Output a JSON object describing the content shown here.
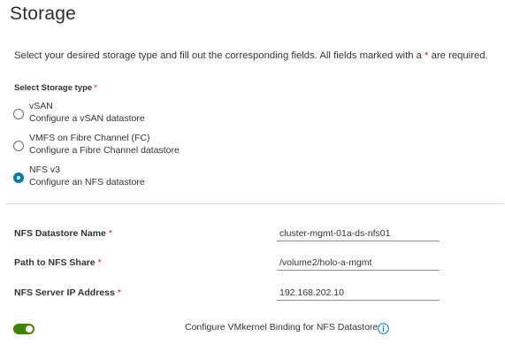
{
  "page": {
    "title": "Storage",
    "instructions_before": "Select your desired storage type and fill out the corresponding fields. All fields marked with a ",
    "required_marker": "*",
    "instructions_after": " are required."
  },
  "storage_type": {
    "label": "Select Storage type",
    "required_marker": "*",
    "options": [
      {
        "title": "vSAN",
        "description": "Configure a vSAN datastore",
        "selected": false
      },
      {
        "title": "VMFS on Fibre Channel (FC)",
        "description": "Configure a Fibre Channel datastore",
        "selected": false
      },
      {
        "title": "NFS v3",
        "description": "Configure an NFS datastore",
        "selected": true
      }
    ]
  },
  "fields": [
    {
      "label": "NFS Datastore Name",
      "required_marker": "*",
      "value": "cluster-mgmt-01a-ds-nfs01"
    },
    {
      "label": "Path to NFS Share",
      "required_marker": "*",
      "value": "/volume2/holo-a-mgmt"
    },
    {
      "label": "NFS Server IP Address",
      "required_marker": "*",
      "value": "192.168.202.10"
    }
  ],
  "vmkernel_binding": {
    "enabled": true,
    "label": "Configure VMkernel Binding for NFS Datastore",
    "icon": "info-icon"
  },
  "colors": {
    "accent": "#0079b8",
    "required": "#c92100",
    "toggle_on": "#3c8500"
  }
}
